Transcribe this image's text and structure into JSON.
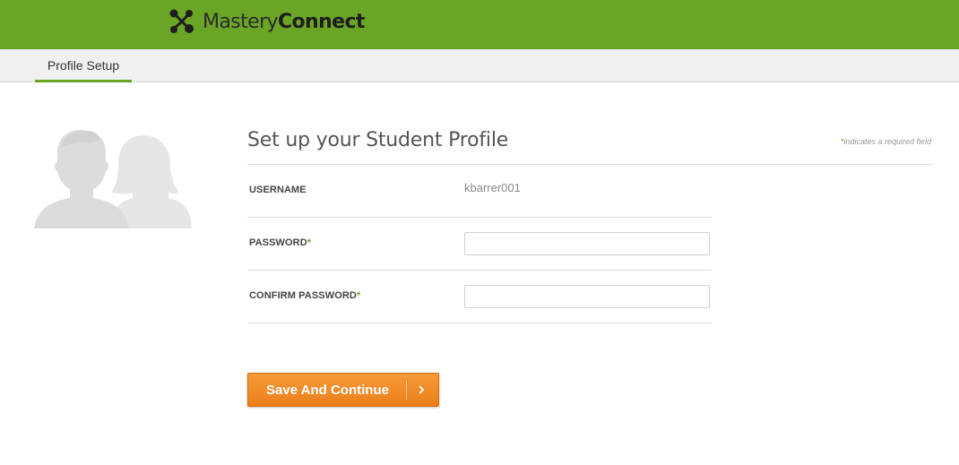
{
  "header": {
    "brand_light": "Mastery",
    "brand_bold": "Connect",
    "brand_color": "#6aa525"
  },
  "tabs": [
    {
      "label": "Profile Setup",
      "active": true
    }
  ],
  "avatar": {
    "icon": "student-profile-icon"
  },
  "form": {
    "title": "Set up your Student Profile",
    "required_note": "indicates a required field",
    "required_star": "*",
    "fields": {
      "username": {
        "label": "USERNAME",
        "value": "kbarrer001"
      },
      "password": {
        "label": "PASSWORD",
        "required": "*",
        "value": "",
        "placeholder": ""
      },
      "confirm_password": {
        "label": "CONFIRM PASSWORD",
        "required": "*",
        "value": "",
        "placeholder": ""
      }
    },
    "submit": {
      "label": "Save And Continue",
      "icon": "chevron-right-icon",
      "color": "#ec7f1a"
    }
  }
}
